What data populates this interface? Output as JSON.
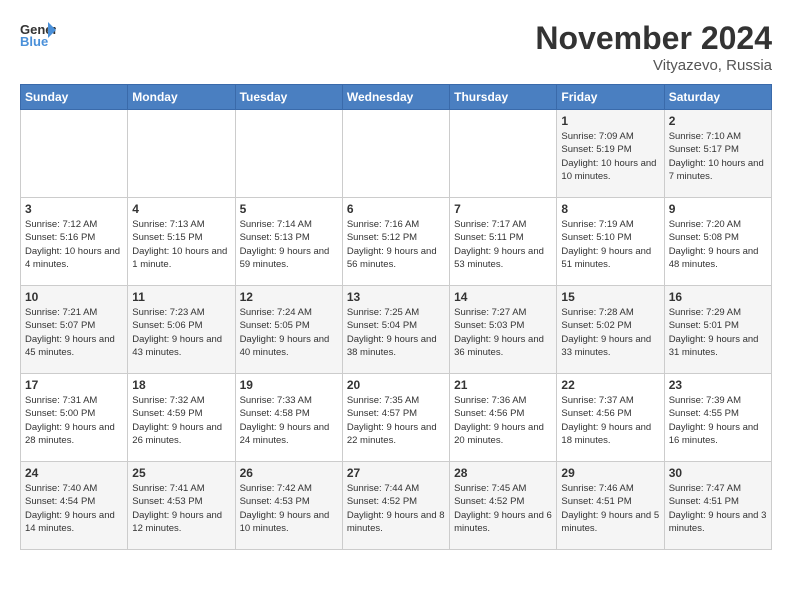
{
  "logo": {
    "text_general": "General",
    "text_blue": "Blue"
  },
  "title": "November 2024",
  "location": "Vityazevo, Russia",
  "days_of_week": [
    "Sunday",
    "Monday",
    "Tuesday",
    "Wednesday",
    "Thursday",
    "Friday",
    "Saturday"
  ],
  "weeks": [
    [
      {
        "day": "",
        "info": ""
      },
      {
        "day": "",
        "info": ""
      },
      {
        "day": "",
        "info": ""
      },
      {
        "day": "",
        "info": ""
      },
      {
        "day": "",
        "info": ""
      },
      {
        "day": "1",
        "info": "Sunrise: 7:09 AM\nSunset: 5:19 PM\nDaylight: 10 hours and 10 minutes."
      },
      {
        "day": "2",
        "info": "Sunrise: 7:10 AM\nSunset: 5:17 PM\nDaylight: 10 hours and 7 minutes."
      }
    ],
    [
      {
        "day": "3",
        "info": "Sunrise: 7:12 AM\nSunset: 5:16 PM\nDaylight: 10 hours and 4 minutes."
      },
      {
        "day": "4",
        "info": "Sunrise: 7:13 AM\nSunset: 5:15 PM\nDaylight: 10 hours and 1 minute."
      },
      {
        "day": "5",
        "info": "Sunrise: 7:14 AM\nSunset: 5:13 PM\nDaylight: 9 hours and 59 minutes."
      },
      {
        "day": "6",
        "info": "Sunrise: 7:16 AM\nSunset: 5:12 PM\nDaylight: 9 hours and 56 minutes."
      },
      {
        "day": "7",
        "info": "Sunrise: 7:17 AM\nSunset: 5:11 PM\nDaylight: 9 hours and 53 minutes."
      },
      {
        "day": "8",
        "info": "Sunrise: 7:19 AM\nSunset: 5:10 PM\nDaylight: 9 hours and 51 minutes."
      },
      {
        "day": "9",
        "info": "Sunrise: 7:20 AM\nSunset: 5:08 PM\nDaylight: 9 hours and 48 minutes."
      }
    ],
    [
      {
        "day": "10",
        "info": "Sunrise: 7:21 AM\nSunset: 5:07 PM\nDaylight: 9 hours and 45 minutes."
      },
      {
        "day": "11",
        "info": "Sunrise: 7:23 AM\nSunset: 5:06 PM\nDaylight: 9 hours and 43 minutes."
      },
      {
        "day": "12",
        "info": "Sunrise: 7:24 AM\nSunset: 5:05 PM\nDaylight: 9 hours and 40 minutes."
      },
      {
        "day": "13",
        "info": "Sunrise: 7:25 AM\nSunset: 5:04 PM\nDaylight: 9 hours and 38 minutes."
      },
      {
        "day": "14",
        "info": "Sunrise: 7:27 AM\nSunset: 5:03 PM\nDaylight: 9 hours and 36 minutes."
      },
      {
        "day": "15",
        "info": "Sunrise: 7:28 AM\nSunset: 5:02 PM\nDaylight: 9 hours and 33 minutes."
      },
      {
        "day": "16",
        "info": "Sunrise: 7:29 AM\nSunset: 5:01 PM\nDaylight: 9 hours and 31 minutes."
      }
    ],
    [
      {
        "day": "17",
        "info": "Sunrise: 7:31 AM\nSunset: 5:00 PM\nDaylight: 9 hours and 28 minutes."
      },
      {
        "day": "18",
        "info": "Sunrise: 7:32 AM\nSunset: 4:59 PM\nDaylight: 9 hours and 26 minutes."
      },
      {
        "day": "19",
        "info": "Sunrise: 7:33 AM\nSunset: 4:58 PM\nDaylight: 9 hours and 24 minutes."
      },
      {
        "day": "20",
        "info": "Sunrise: 7:35 AM\nSunset: 4:57 PM\nDaylight: 9 hours and 22 minutes."
      },
      {
        "day": "21",
        "info": "Sunrise: 7:36 AM\nSunset: 4:56 PM\nDaylight: 9 hours and 20 minutes."
      },
      {
        "day": "22",
        "info": "Sunrise: 7:37 AM\nSunset: 4:56 PM\nDaylight: 9 hours and 18 minutes."
      },
      {
        "day": "23",
        "info": "Sunrise: 7:39 AM\nSunset: 4:55 PM\nDaylight: 9 hours and 16 minutes."
      }
    ],
    [
      {
        "day": "24",
        "info": "Sunrise: 7:40 AM\nSunset: 4:54 PM\nDaylight: 9 hours and 14 minutes."
      },
      {
        "day": "25",
        "info": "Sunrise: 7:41 AM\nSunset: 4:53 PM\nDaylight: 9 hours and 12 minutes."
      },
      {
        "day": "26",
        "info": "Sunrise: 7:42 AM\nSunset: 4:53 PM\nDaylight: 9 hours and 10 minutes."
      },
      {
        "day": "27",
        "info": "Sunrise: 7:44 AM\nSunset: 4:52 PM\nDaylight: 9 hours and 8 minutes."
      },
      {
        "day": "28",
        "info": "Sunrise: 7:45 AM\nSunset: 4:52 PM\nDaylight: 9 hours and 6 minutes."
      },
      {
        "day": "29",
        "info": "Sunrise: 7:46 AM\nSunset: 4:51 PM\nDaylight: 9 hours and 5 minutes."
      },
      {
        "day": "30",
        "info": "Sunrise: 7:47 AM\nSunset: 4:51 PM\nDaylight: 9 hours and 3 minutes."
      }
    ]
  ]
}
